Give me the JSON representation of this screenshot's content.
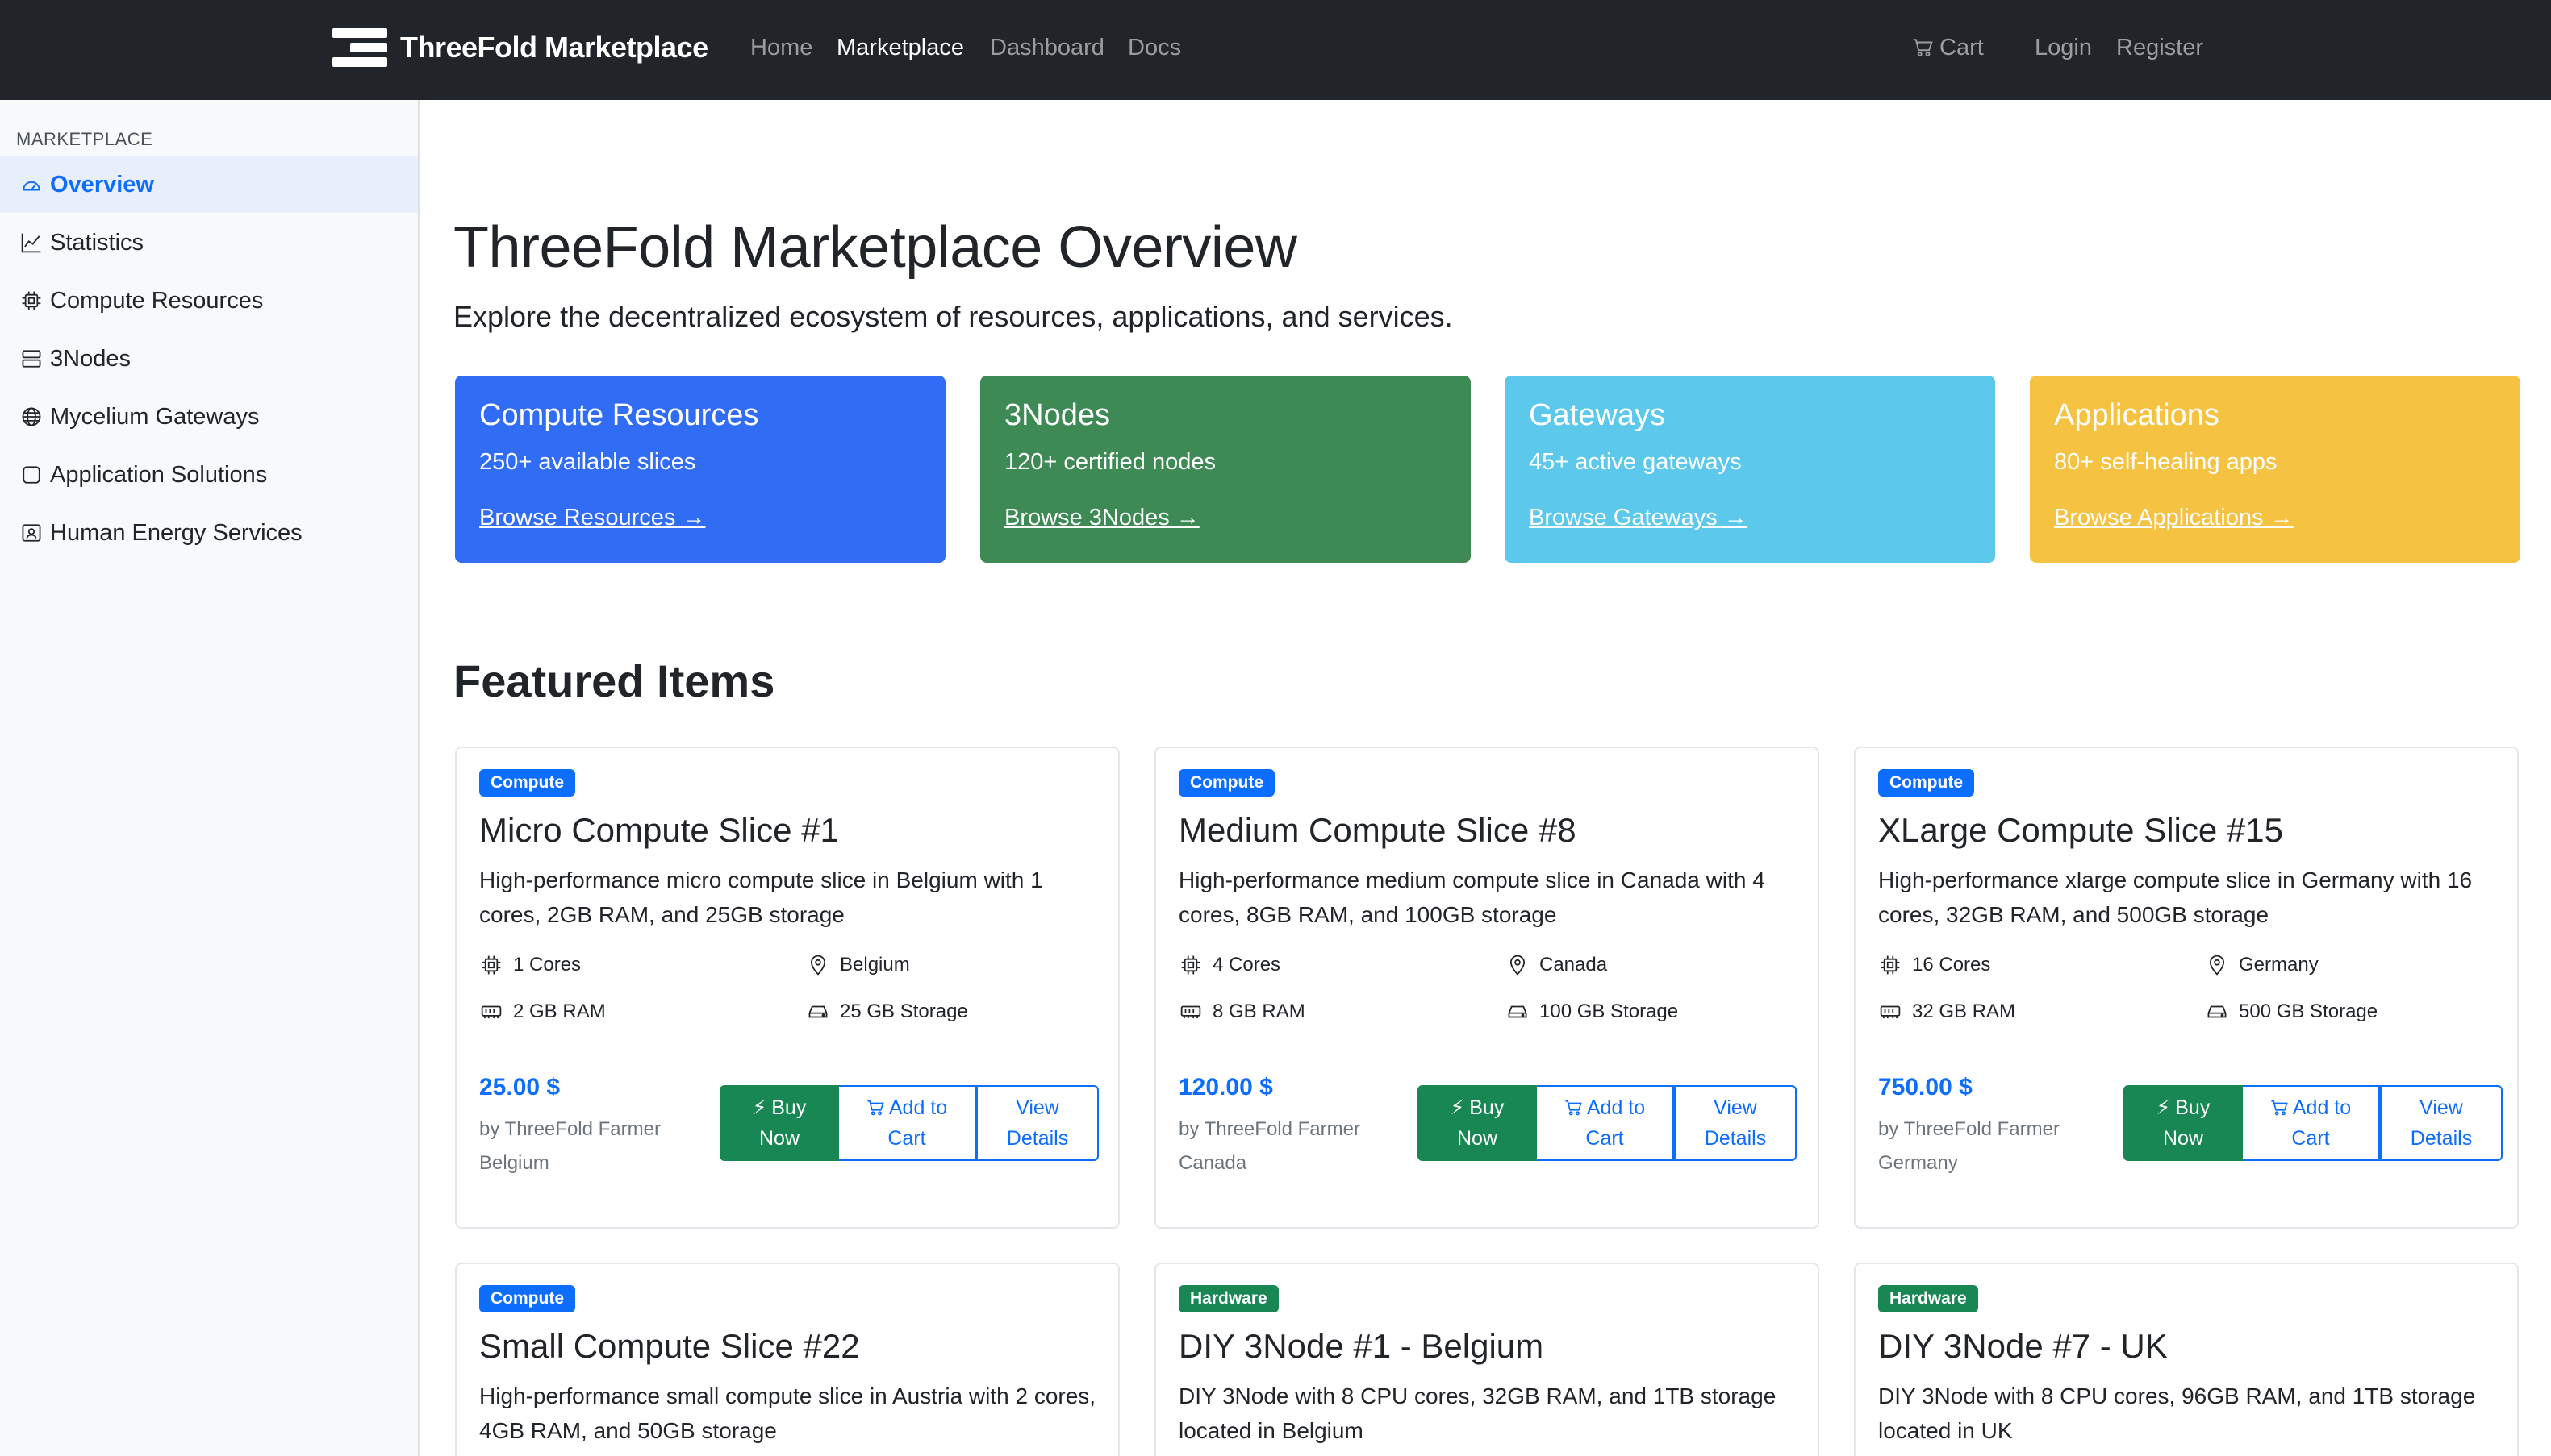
{
  "navbar": {
    "brand": "ThreeFold Marketplace",
    "links": [
      "Home",
      "Marketplace",
      "Dashboard",
      "Docs"
    ],
    "active_link": "Marketplace",
    "cart": "Cart",
    "login": "Login",
    "register": "Register"
  },
  "sidebar": {
    "heading": "MARKETPLACE",
    "items": [
      {
        "label": "Overview",
        "icon": "speedometer-icon",
        "active": true
      },
      {
        "label": "Statistics",
        "icon": "graph-up-icon"
      },
      {
        "label": "Compute Resources",
        "icon": "cpu-icon"
      },
      {
        "label": "3Nodes",
        "icon": "server-icon"
      },
      {
        "label": "Mycelium Gateways",
        "icon": "globe-icon"
      },
      {
        "label": "Application Solutions",
        "icon": "app-icon"
      },
      {
        "label": "Human Energy Services",
        "icon": "person-badge-icon"
      }
    ]
  },
  "main": {
    "title": "ThreeFold Marketplace Overview",
    "lead": "Explore the decentralized ecosystem of resources, applications, and services.",
    "stat_cards": [
      {
        "title": "Compute Resources",
        "subtitle": "250+ available slices",
        "link": "Browse Resources →",
        "color": "#316cf4"
      },
      {
        "title": "3Nodes",
        "subtitle": "120+ certified nodes",
        "link": "Browse 3Nodes →",
        "color": "#3d8a55"
      },
      {
        "title": "Gateways",
        "subtitle": "45+ active gateways",
        "link": "Browse Gateways →",
        "color": "#5bc8ec"
      },
      {
        "title": "Applications",
        "subtitle": "80+ self-healing apps",
        "link": "Browse Applications →",
        "color": "#f5c242"
      }
    ],
    "featured_title": "Featured Items",
    "buttons": {
      "buy_1": "Buy",
      "buy_2": "Now",
      "cart_1": "Add to",
      "cart_2": "Cart",
      "view_1": "View",
      "view_2": "Details"
    },
    "products": [
      {
        "badge": "Compute",
        "title": "Micro Compute Slice #1",
        "description": "High-performance micro compute slice in Belgium with 1 cores, 2GB RAM, and 25GB storage",
        "cores": "1 Cores",
        "location": "Belgium",
        "ram": "2 GB RAM",
        "storage": "25 GB Storage",
        "price": "25.00 $",
        "seller": "by ThreeFold Farmer Belgium"
      },
      {
        "badge": "Compute",
        "title": "Medium Compute Slice #8",
        "description": "High-performance medium compute slice in Canada with 4 cores, 8GB RAM, and 100GB storage",
        "cores": "4 Cores",
        "location": "Canada",
        "ram": "8 GB RAM",
        "storage": "100 GB Storage",
        "price": "120.00 $",
        "seller": "by ThreeFold Farmer Canada"
      },
      {
        "badge": "Compute",
        "title": "XLarge Compute Slice #15",
        "description": "High-performance xlarge compute slice in Germany with 16 cores, 32GB RAM, and 500GB storage",
        "cores": "16 Cores",
        "location": "Germany",
        "ram": "32 GB RAM",
        "storage": "500 GB Storage",
        "price": "750.00 $",
        "seller": "by ThreeFold Farmer Germany"
      },
      {
        "badge": "Compute",
        "title": "Small Compute Slice #22",
        "description": "High-performance small compute slice in Austria with 2 cores, 4GB RAM, and 50GB storage"
      },
      {
        "badge": "Hardware",
        "title": "DIY 3Node #1 - Belgium",
        "description": "DIY 3Node with 8 CPU cores, 32GB RAM, and 1TB storage located in Belgium"
      },
      {
        "badge": "Hardware",
        "title": "DIY 3Node #7 - UK",
        "description": "DIY 3Node with 8 CPU cores, 96GB RAM, and 1TB storage located in UK"
      }
    ]
  }
}
